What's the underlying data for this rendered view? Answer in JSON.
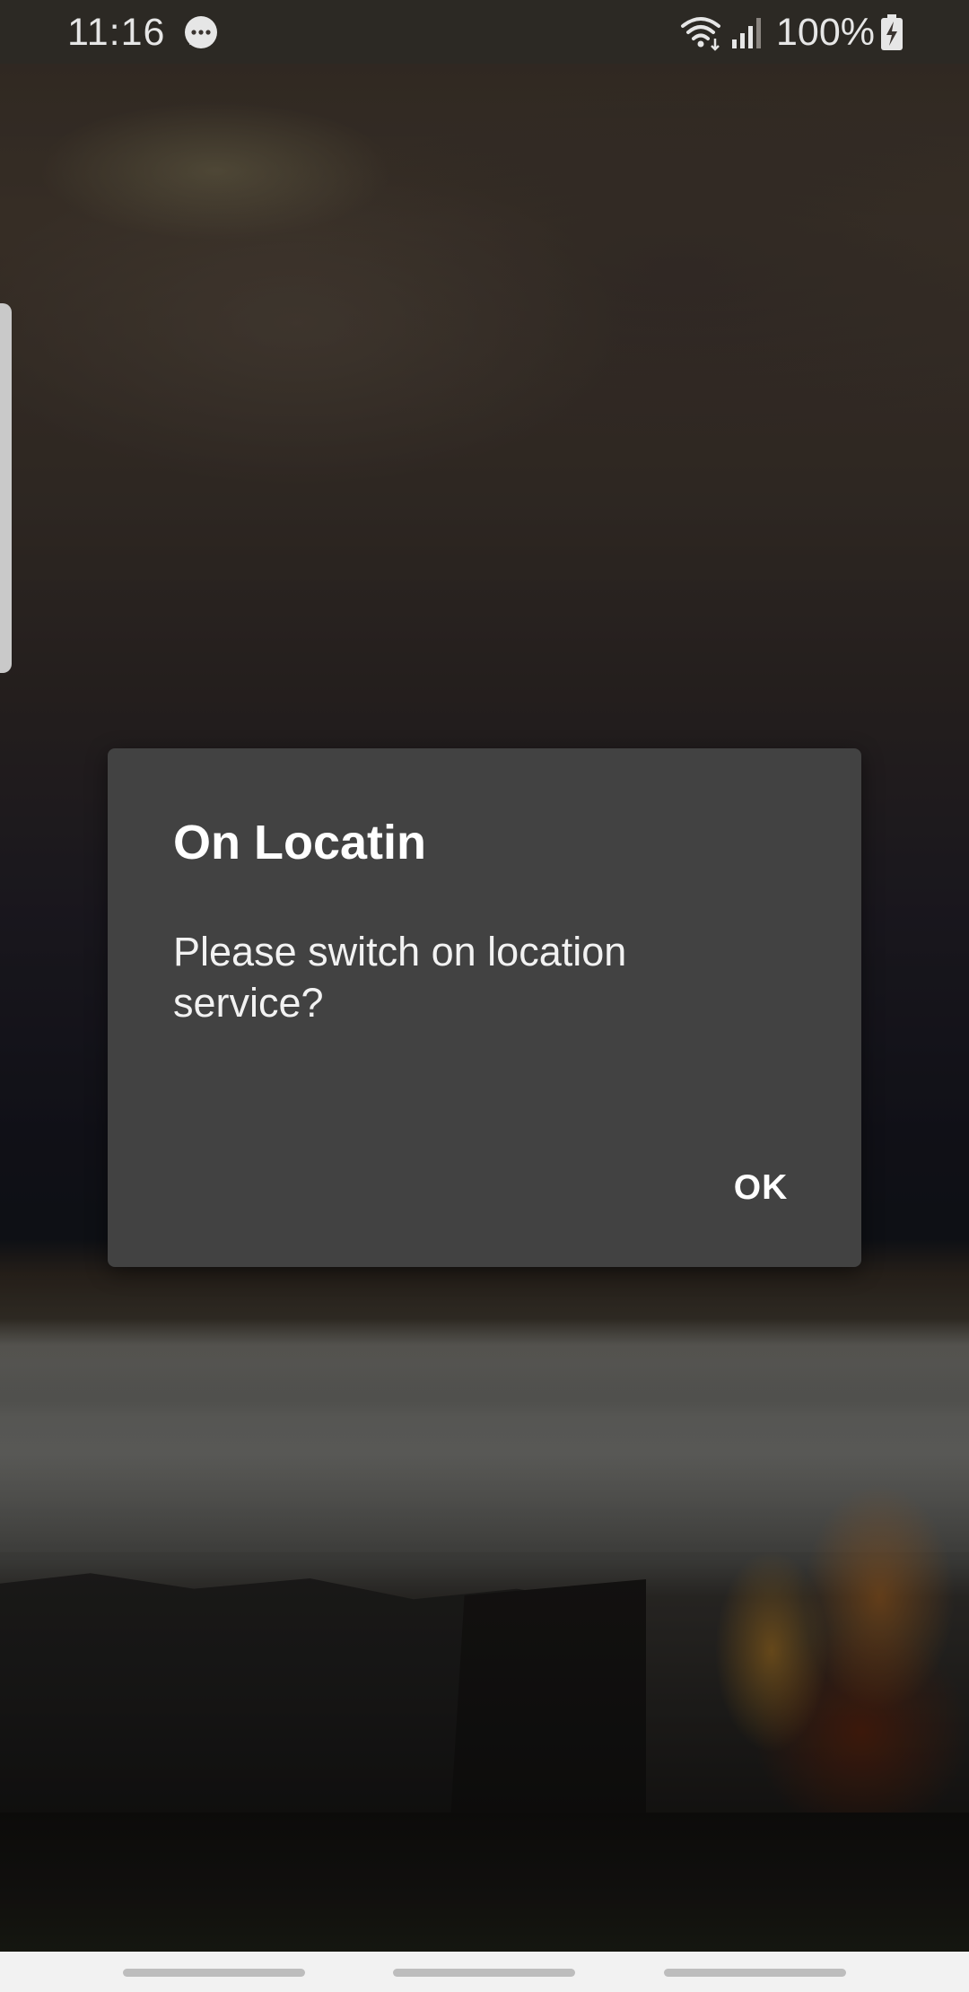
{
  "status_bar": {
    "time": "11:16",
    "battery_percent": "100%",
    "icons": [
      "message-bubble-icon",
      "wifi-icon",
      "cell-signal-icon",
      "battery-charging-icon"
    ]
  },
  "dialog": {
    "title": "On Locatin",
    "message": "Please switch on location service?",
    "ok_label": "OK"
  },
  "nav_bar": {
    "buttons": [
      "recents-button",
      "home-button",
      "back-button"
    ]
  },
  "colors": {
    "dialog_background": "#424242",
    "dialog_text": "#ffffff",
    "nav_bar_background": "#f2f2f2",
    "status_text": "#e6e6e6"
  }
}
